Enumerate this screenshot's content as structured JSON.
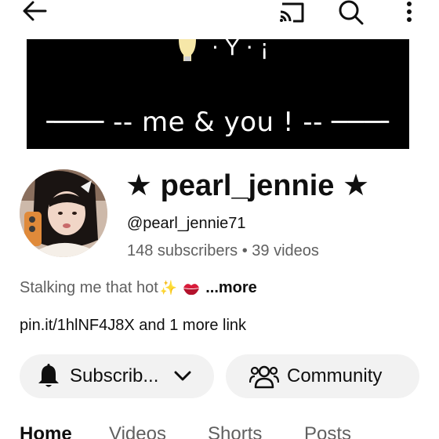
{
  "banner": {
    "text": "╶─── -- me & you ! -- ───╴",
    "deco": "· Ẏ · ¡"
  },
  "channel": {
    "name": "★ pearl_jennie ★",
    "handle": "@pearl_jennie71",
    "stats": "148 subscribers • 39 videos",
    "description": "Stalking me that hot",
    "more_label": "...more",
    "link_url": "pin.it/1hlNF4J8X",
    "link_more": " and 1 more link"
  },
  "actions": {
    "subscribe_label": "Subscrib...",
    "community_label": "Community"
  },
  "tabs": [
    "Home",
    "Videos",
    "Shorts",
    "Posts"
  ],
  "icons": {
    "back": "arrow-left",
    "cast": "cast",
    "search": "search",
    "more": "vertical-dots",
    "bell": "bell",
    "community": "people"
  }
}
